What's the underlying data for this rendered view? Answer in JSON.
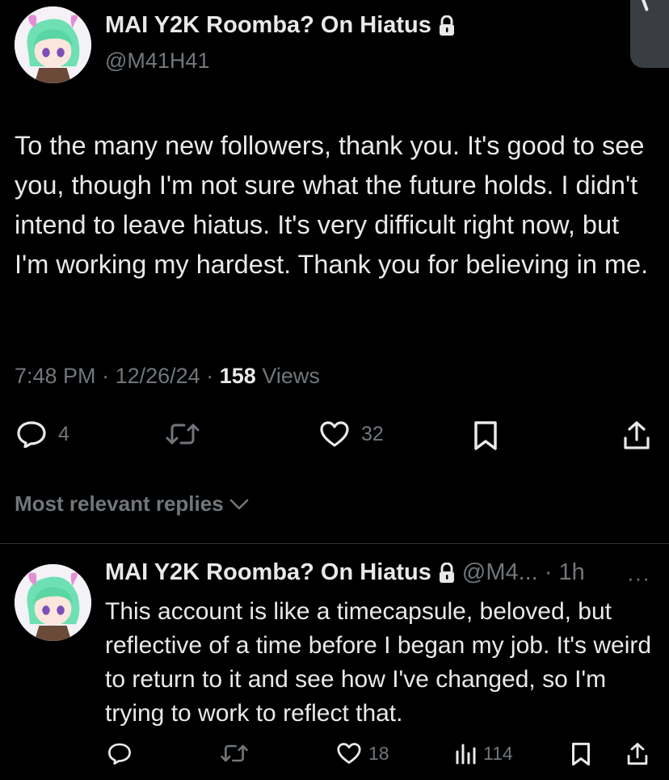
{
  "post": {
    "author_name": "MAI Y2K Roomba? On Hiatus",
    "author_handle": "@M41H41",
    "text": "To the many new followers, thank you. It's good to see you, though I'm not sure what the future holds. I didn't intend to leave hiatus. It's very difficult right now, but I'm working my hardest. Thank you for believing in me.",
    "time": "7:48 PM",
    "date": "12/26/24",
    "separator": "·",
    "views_count": "158",
    "views_label": "Views",
    "replies_count": "4",
    "reposts_count": "",
    "likes_count": "32"
  },
  "replies_section": {
    "label": "Most relevant replies"
  },
  "reply": {
    "author_name": "MAI Y2K Roomba? On Hiatus",
    "handle_time": "@M4... · 1h",
    "more": "···",
    "text": "This account is like a timecapsule, beloved, but reflective of a time before I began my job. It's weird to return to it and see how I've changed, so I'm trying to work to reflect that.",
    "replies_count": "",
    "reposts_count": "",
    "likes_count": "18",
    "views_count": "114"
  },
  "icons": {
    "lock": "lock-icon",
    "reply": "reply-icon",
    "repost": "repost-icon",
    "like": "heart-icon",
    "bookmark": "bookmark-icon",
    "share": "share-icon",
    "views": "views-icon",
    "chevron": "chevron-down-icon"
  },
  "colors": {
    "background": "#000000",
    "text_primary": "#e7e9ea",
    "text_secondary": "#71767b",
    "divider": "#2f3336"
  }
}
